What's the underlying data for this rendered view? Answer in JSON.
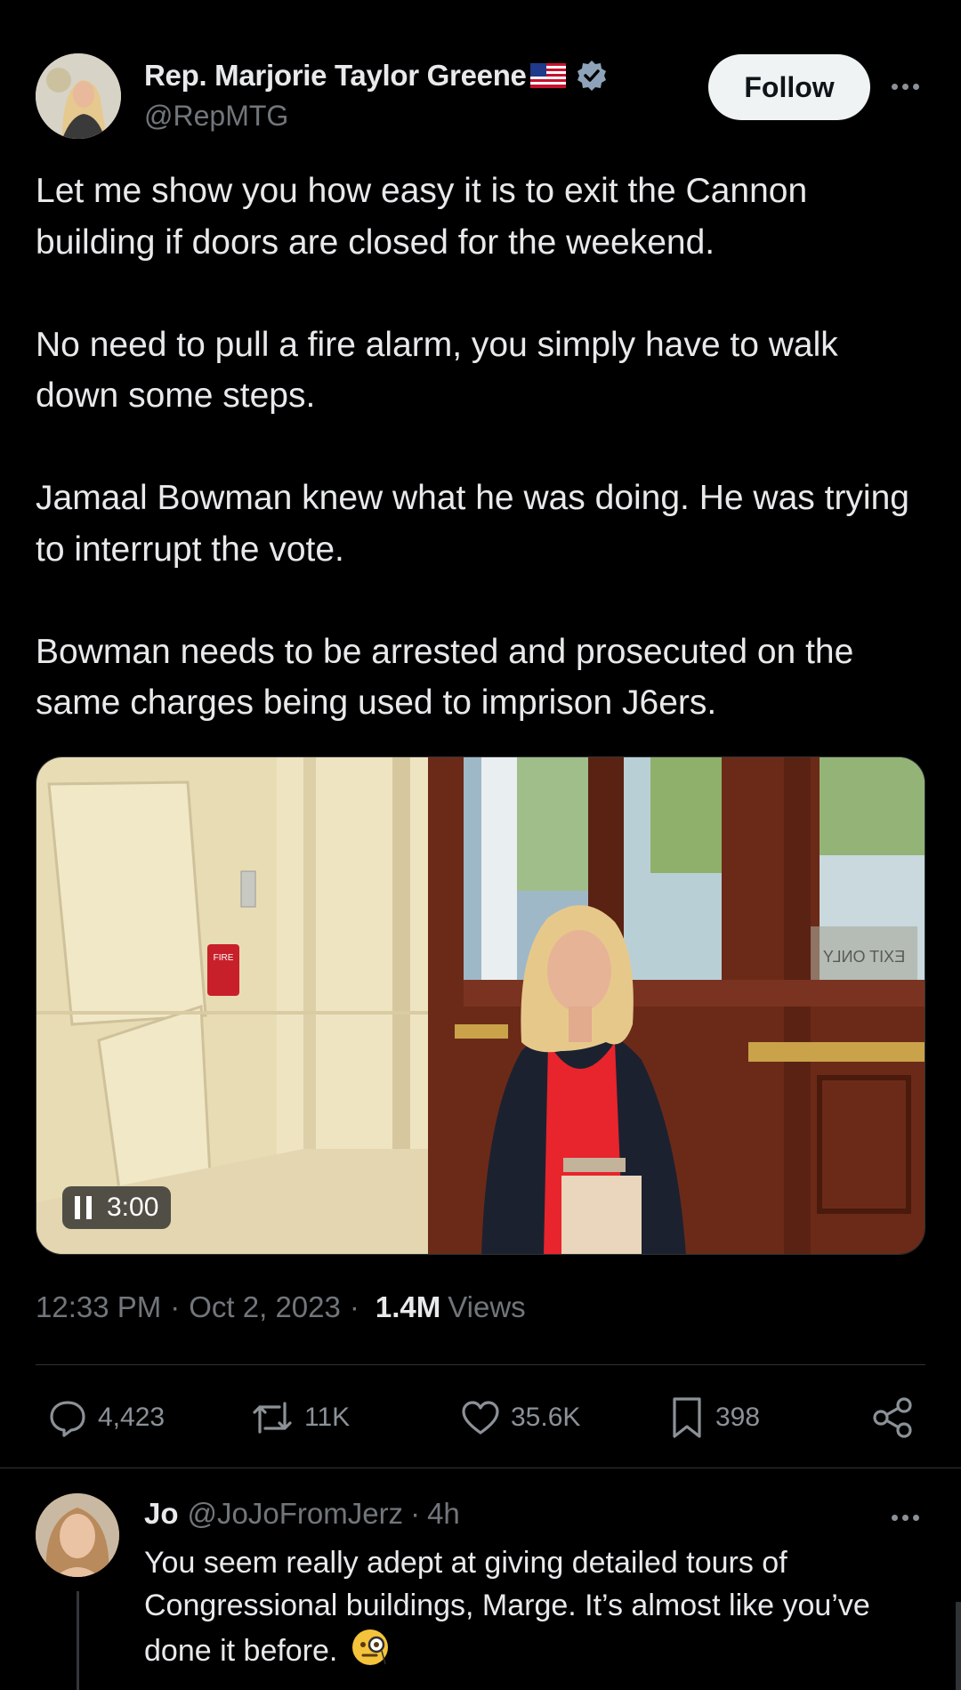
{
  "author": {
    "name": "Rep. Marjorie Taylor Greene",
    "handle": "@RepMTG",
    "verified": true
  },
  "follow_label": "Follow",
  "tweet": {
    "text": "Let me show you how easy it is to exit the Cannon building if doors are closed for the weekend.\n\nNo need to pull a fire alarm, you simply have to walk down some steps.\n\nJamaal Bowman knew what he was doing. He was trying to interrupt the vote.\n\nBowman needs to be arrested and prosecuted on the same charges being used to imprison J6ers.",
    "video": {
      "duration": "3:00",
      "alarm_label": "FIRE",
      "door_sign": "EXIT ONLY"
    },
    "time": "12:33 PM",
    "date": "Oct 2, 2023",
    "views_count": "1.4M",
    "views_label": "Views"
  },
  "actions": {
    "replies": "4,423",
    "retweets": "11K",
    "likes": "35.6K",
    "bookmarks": "398"
  },
  "reply": {
    "name": "Jo",
    "handle": "@JoJoFromJerz",
    "age": "4h",
    "text": "You seem really adept at giving detailed tours of Congressional buildings, Marge. It’s almost like you’ve done it before."
  },
  "colors": {
    "background": "#000000",
    "text": "#e7e9ea",
    "muted": "#71767b",
    "verified": "#8ea2b8",
    "divider": "#2f3336"
  }
}
